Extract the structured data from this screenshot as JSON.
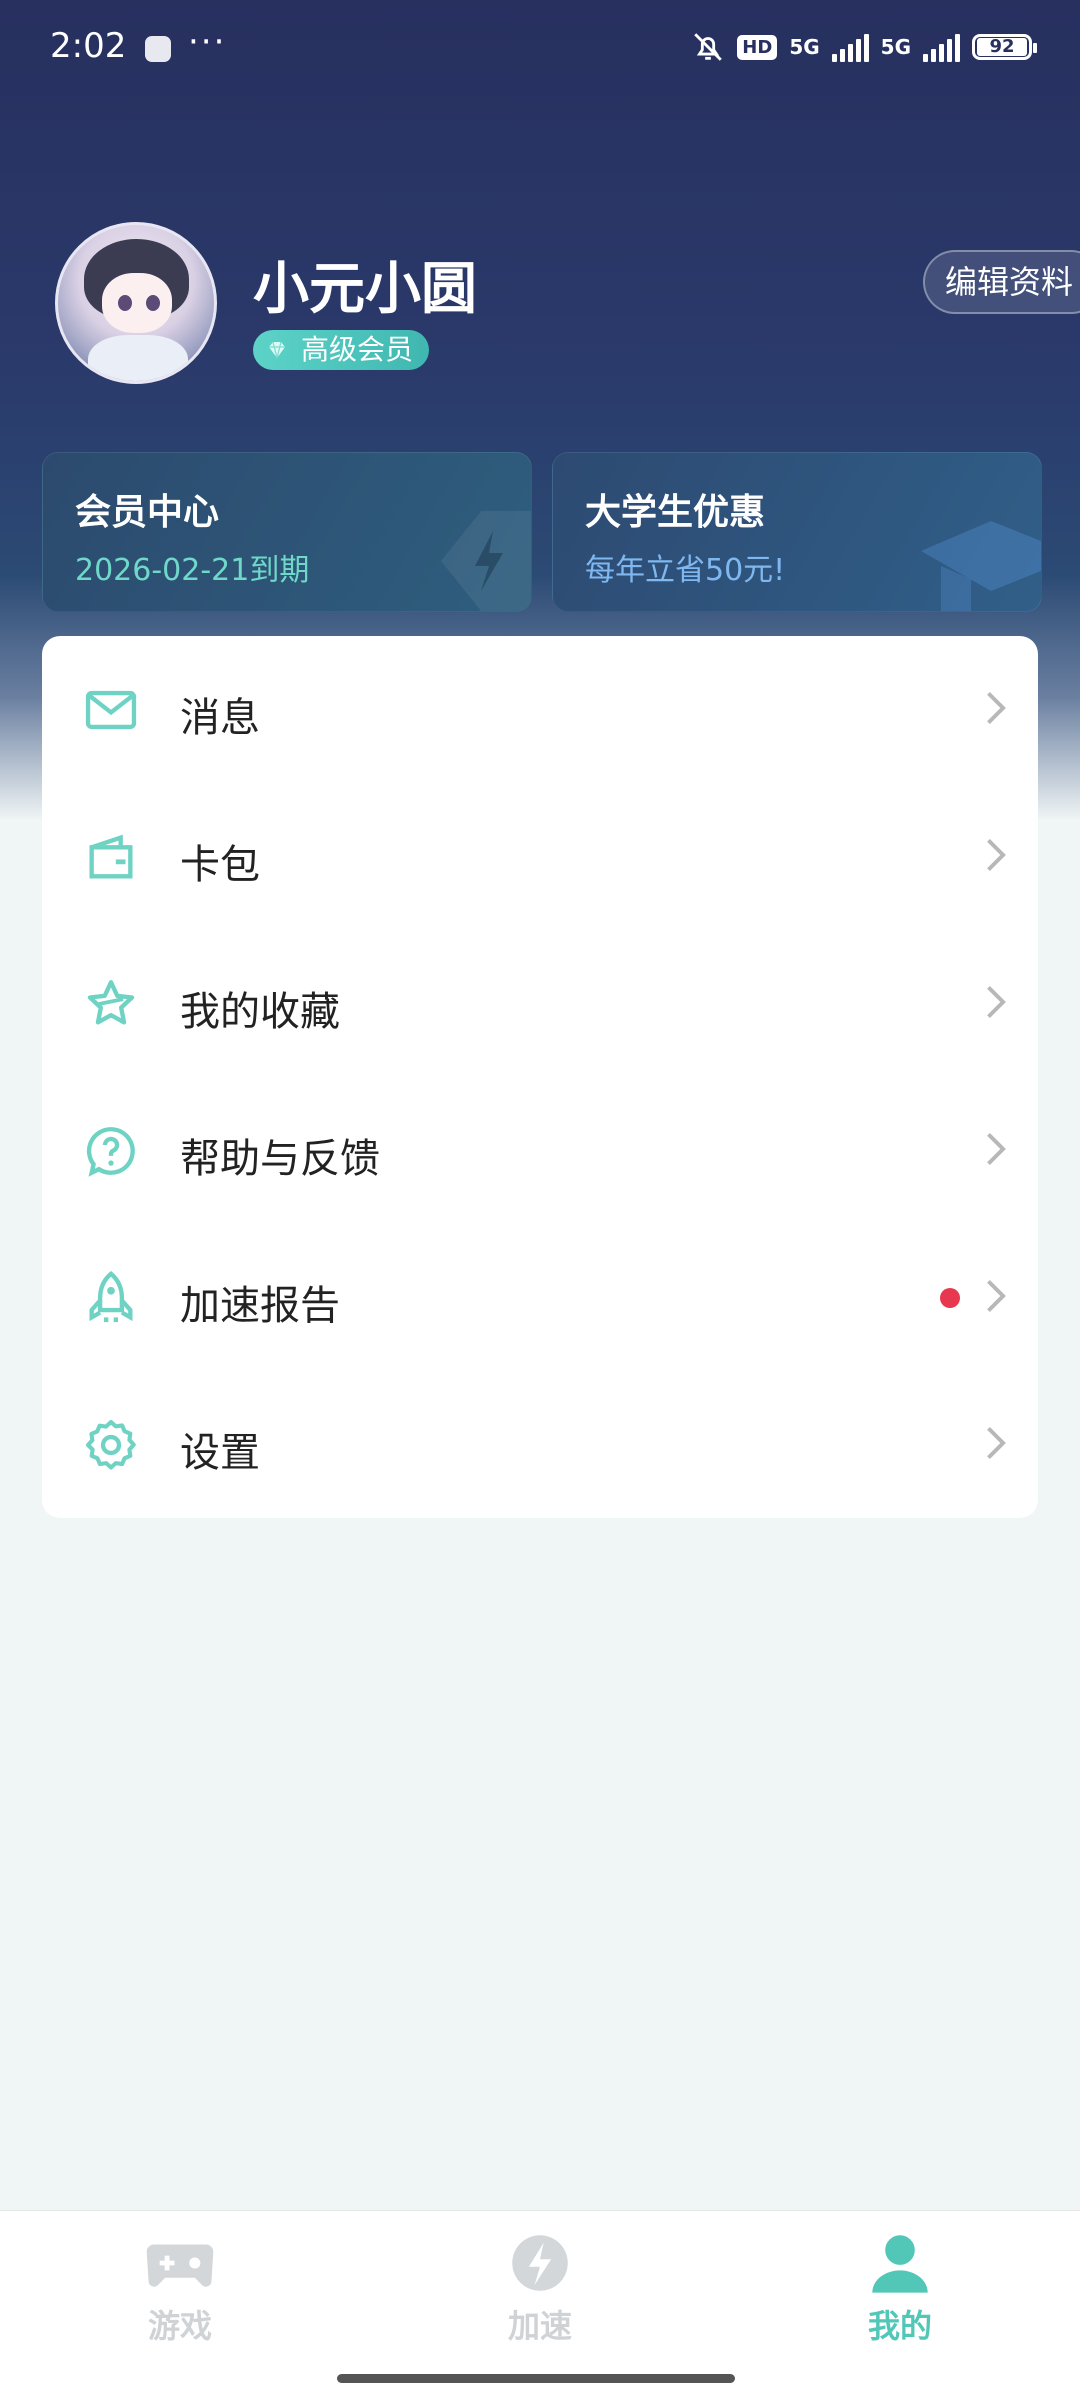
{
  "status_bar": {
    "time": "2:02",
    "dots": "···",
    "hd": "HD",
    "sim1": "5G",
    "sim2": "5G",
    "battery": "92"
  },
  "profile": {
    "name": "小元小圆",
    "member_badge": "高级会员",
    "edit_label": "编辑资料"
  },
  "cards": [
    {
      "title": "会员中心",
      "subtitle": "2026-02-21到期"
    },
    {
      "title": "大学生优惠",
      "subtitle": "每年立省50元!"
    }
  ],
  "menu": [
    {
      "label": "消息",
      "icon": "mail-icon"
    },
    {
      "label": "卡包",
      "icon": "wallet-icon"
    },
    {
      "label": "我的收藏",
      "icon": "star-icon"
    },
    {
      "label": "帮助与反馈",
      "icon": "help-icon"
    },
    {
      "label": "加速报告",
      "icon": "rocket-icon",
      "badge": true
    },
    {
      "label": "设置",
      "icon": "gear-icon"
    }
  ],
  "tabs": [
    {
      "label": "游戏",
      "icon": "gamepad-icon",
      "active": false
    },
    {
      "label": "加速",
      "icon": "lightning-icon",
      "active": false
    },
    {
      "label": "我的",
      "icon": "person-icon",
      "active": true
    }
  ],
  "colors": {
    "accent": "#52c7b8",
    "header": "#27305f",
    "dot": "#e8384f"
  }
}
